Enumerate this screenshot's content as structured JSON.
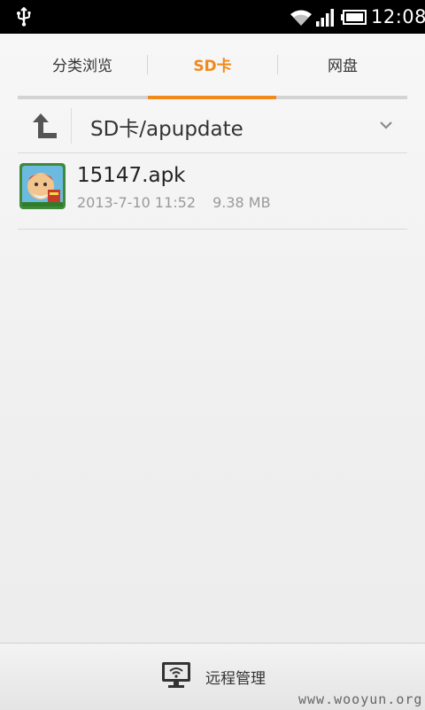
{
  "status_bar": {
    "time": "12:08",
    "icons": [
      "usb-icon",
      "wifi-icon",
      "signal-icon",
      "battery-icon"
    ]
  },
  "tabs": [
    {
      "label": "分类浏览",
      "active": false
    },
    {
      "label": "SD卡",
      "active": true
    },
    {
      "label": "网盘",
      "active": false
    }
  ],
  "colors": {
    "accent": "#ef8a1b"
  },
  "path_bar": {
    "path": "SD卡/apupdate",
    "up_icon": "up-arrow-icon",
    "dropdown_icon": "chevron-down-icon"
  },
  "files": [
    {
      "name": "15147.apk",
      "date": "2013-7-10 11:52",
      "size": "9.38 MB",
      "icon": "app-icon"
    }
  ],
  "bottom_bar": {
    "label": "远程管理",
    "icon": "monitor-wifi-icon"
  },
  "watermark": "www.wooyun.org"
}
